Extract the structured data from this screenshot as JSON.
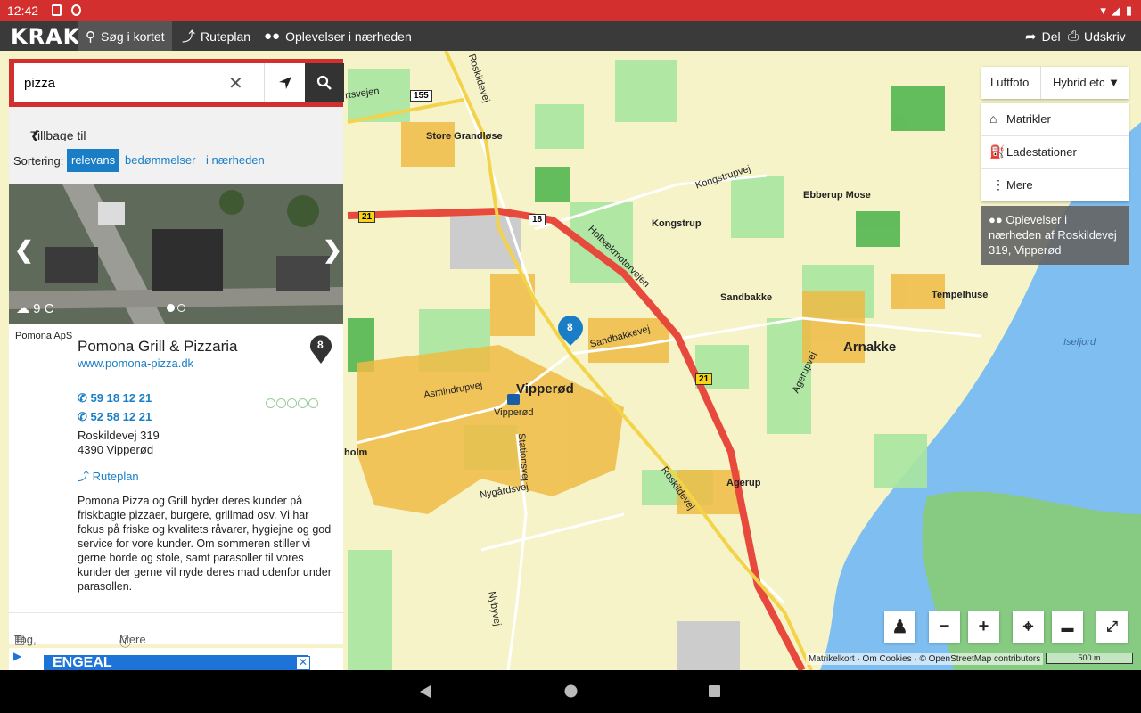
{
  "status": {
    "time": "12:42"
  },
  "nav": {
    "logo": "KRAK",
    "tab_search": "Søg i kortet",
    "tab_route": "Ruteplan",
    "tab_experiences": "Oplevelser i nærheden",
    "share": "Del",
    "print": "Udskriv"
  },
  "search": {
    "value": "pizza",
    "placeholder": ""
  },
  "back_label": "Tillbage til resultatliste",
  "sorting": {
    "label": "Sortering:",
    "options": [
      "relevans",
      "bedømmelser",
      "i nærheden"
    ],
    "active": "relevans"
  },
  "photo": {
    "weather": "9 C"
  },
  "result": {
    "company": "Pomona ApS",
    "name": "Pomona Grill & Pizzaria",
    "website": "www.pomona-pizza.dk",
    "marker_number": "8",
    "phones": [
      "59 18 12 21",
      "52 58 12 21"
    ],
    "address_line1": "Roskildevej 319",
    "address_line2": "4390 Vipperød",
    "route_label": "Ruteplan",
    "description": "Pomona Pizza og Grill byder deres kunder på friskbagte pizzaer, burgere, grillmad osv. Vi har fokus på friske og kvalitets råvarer, hygiejne og god service for vore kunder. Om sommeren stiller vi gerne borde og stole, samt parasoller til vores kunder der gerne vil nyde deres mad udenfor under parasollen.",
    "rating_stars": 0,
    "transit_label": "Tog, Bus & Metro",
    "more_info_label": "Mere info"
  },
  "ad": {
    "text": "ENGEAL"
  },
  "layers": {
    "aerial": "Luftfoto",
    "hybrid": "Hybrid etc"
  },
  "menu": {
    "items": [
      "Matrikler",
      "Ladestationer",
      "Mere"
    ]
  },
  "experiences_box": "Oplevelser i nærheden af Roskildevej 319, Vipperød",
  "map": {
    "places": [
      "Store Grandløse",
      "Ebberup Mose",
      "Kongstrup",
      "Sandbakke",
      "Tempelhuse",
      "Arnakke",
      "Vipperød",
      "Agerup",
      "holm",
      "Isefjord"
    ],
    "roads": [
      "Roskildevej",
      "Kongstrupvej",
      "Holbækmotorvejen",
      "Sandbakkevej",
      "Asmindrupvej",
      "Stationsvej",
      "Nygårdsvej",
      "Nybyvej",
      "Agerupvej",
      "rtsvejen"
    ],
    "shields": [
      "155",
      "21",
      "18",
      "21"
    ],
    "pin_number": "8",
    "station_label": "Vipperød",
    "attribution": "Matrikelkort · Om Cookies · © OpenStreetMap contributors",
    "scale": "500 m"
  },
  "colors": {
    "brand_red": "#d32f2f",
    "link_blue": "#1a7ec6",
    "nav_dark": "#3a3a3a"
  }
}
